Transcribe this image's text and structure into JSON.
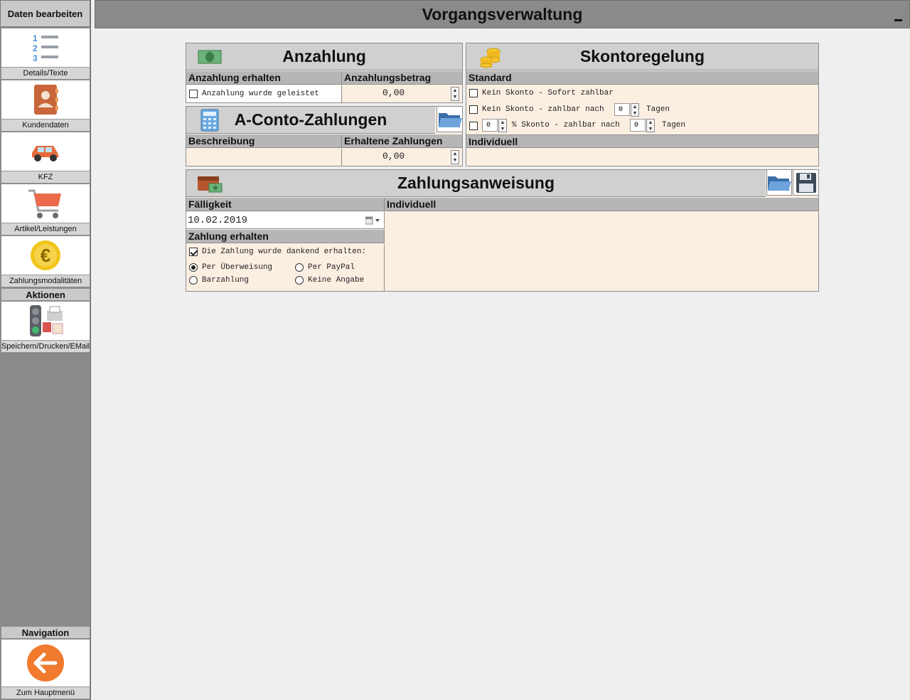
{
  "sidebar": {
    "header": "Daten bearbeiten",
    "items": [
      {
        "label": "Details/Texte",
        "icon": "numbered-list-icon"
      },
      {
        "label": "Kundendaten",
        "icon": "contact-book-icon"
      },
      {
        "label": "KFZ",
        "icon": "car-icon"
      },
      {
        "label": "Artikel/Leistungen",
        "icon": "shopping-cart-icon"
      },
      {
        "label": "Zahlungsmodalitäten",
        "icon": "euro-coin-icon"
      }
    ],
    "actions_title": "Aktionen",
    "actions": [
      {
        "label": "Speichern/Drucken/EMail",
        "icon": "traffic-light-printer-icon"
      }
    ],
    "navigation_title": "Navigation",
    "navigation": [
      {
        "label": "Zum Hauptmenü",
        "icon": "back-arrow-icon"
      }
    ]
  },
  "header": {
    "title": "Vorgangsverwaltung"
  },
  "anzahlung": {
    "title": "Anzahlung",
    "col1": "Anzahlung erhalten",
    "col2": "Anzahlungsbetrag",
    "checkbox_label": "Anzahlung wurde geleistet",
    "checkbox_checked": false,
    "amount": "0,00"
  },
  "aconto": {
    "title": "A-Conto-Zahlungen",
    "col1": "Beschreibung",
    "col2": "Erhaltene Zahlungen",
    "amount": "0,00"
  },
  "skonto": {
    "title": "Skontoregelung",
    "standard": "Standard",
    "opt1": "Kein Skonto - Sofort zahlbar",
    "opt2_prefix": "Kein Skonto - zahlbar nach",
    "opt2_days": "0",
    "opt2_suffix": "Tagen",
    "opt3_percent": "0",
    "opt3_mid": "% Skonto - zahlbar nach",
    "opt3_days": "0",
    "opt3_suffix": "Tagen",
    "individuell": "Individuell"
  },
  "zahlungsanweisung": {
    "title": "Zahlungsanweisung",
    "faelligkeit": "Fälligkeit",
    "date": "10.02.2019",
    "individuell": "Individuell",
    "zahlung_erhalten": "Zahlung erhalten",
    "received_label": "Die Zahlung wurde dankend erhalten:",
    "received_checked": true,
    "radio_ueberweisung": "Per Überweisung",
    "radio_paypal": "Per PayPal",
    "radio_bar": "Barzahlung",
    "radio_keine": "Keine Angabe",
    "selected_method": "Per Überweisung"
  }
}
